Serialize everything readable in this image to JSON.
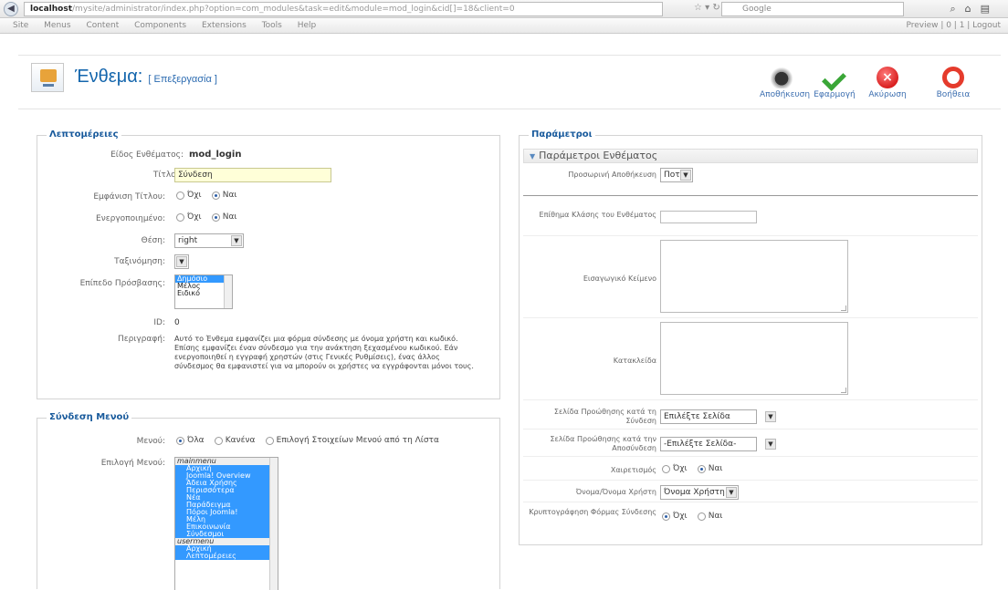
{
  "browser": {
    "url_host": "localhost",
    "url_rest": "/mysite/administrator/index.php?option=com_modules&task=edit&module=mod_login&cid[]=18&client=0",
    "search_placeholder": "Google"
  },
  "admin_menu": {
    "items": [
      "Site",
      "Menus",
      "Content",
      "Components",
      "Extensions",
      "Tools",
      "Help"
    ],
    "right": "Preview  |  0  |  1  |  Logout"
  },
  "toolbar": {
    "title": "Ένθεμα:",
    "subtitle": "[ Επεξεργασία ]",
    "save": "Αποθήκευση",
    "apply": "Εφαρμογή",
    "close": "Ακύρωση",
    "help": "Βοήθεια"
  },
  "details": {
    "legend": "Λεπτομέρειες",
    "module_type_label": "Είδος Ενθέματος:",
    "module_type_value": "mod_login",
    "title_label": "Τίτλος:",
    "title_value": "Σύνδεση",
    "show_title_label": "Εμφάνιση Τίτλου:",
    "enabled_label": "Ενεργοποιημένο:",
    "no": "Όχι",
    "yes": "Ναι",
    "position_label": "Θέση:",
    "position_value": "right",
    "order_label": "Ταξινόμηση:",
    "access_label": "Επίπεδο Πρόσβασης:",
    "access_options": [
      "Δημόσιο",
      "Μέλος",
      "Ειδικό"
    ],
    "id_label": "ID:",
    "id_value": "0",
    "desc_label": "Περιγραφή:",
    "desc_value": "Αυτό το Ένθεμα εμφανίζει μια φόρμα σύνδεσης με όνομα χρήστη και κωδικό. Επίσης εμφανίζει έναν σύνδεσμο για την ανάκτηση ξεχασμένου κωδικού. Εάν ενεργοποιηθεί η εγγραφή χρηστών (στις Γενικές Ρυθμίσεις), ένας άλλος σύνδεσμος θα εμφανιστεί για να μπορούν οι χρήστες να εγγράφονται μόνοι τους."
  },
  "menu_assign": {
    "legend": "Σύνδεση Μενού",
    "menus_label": "Μενού:",
    "opt_all": "Όλα",
    "opt_none": "Κανένα",
    "opt_select": "Επιλογή Στοιχείων Μενού από τη Λίστα",
    "selection_label": "Επιλογή Μενού:",
    "list": [
      {
        "text": "mainmenu",
        "kind": "grp"
      },
      {
        "text": "Αρχική",
        "kind": "on"
      },
      {
        "text": "Joomla! Overview",
        "kind": "on"
      },
      {
        "text": "Άδεια Χρήσης",
        "kind": "on"
      },
      {
        "text": "Περισσότερα",
        "kind": "on"
      },
      {
        "text": "Νέα",
        "kind": "on"
      },
      {
        "text": "Παράδειγμα",
        "kind": "on"
      },
      {
        "text": "Πόροι Joomla!",
        "kind": "on"
      },
      {
        "text": "Μέλη",
        "kind": "on"
      },
      {
        "text": "Επικοινωνία",
        "kind": "on"
      },
      {
        "text": "Σύνδεσμοι",
        "kind": "on"
      },
      {
        "text": "usermenu",
        "kind": "grp"
      },
      {
        "text": "Αρχική",
        "kind": "on"
      },
      {
        "text": "Λεπτομέρειες",
        "kind": "on"
      }
    ]
  },
  "params": {
    "legend": "Παράμετροι",
    "panel_title": "Παράμετροι Ενθέματος",
    "cache_label": "Προσωρινή Αποθήκευση",
    "cache_value": "Ποτέ",
    "class_suffix_label": "Επίθημα Κλάσης του Ενθέματος",
    "pretext_label": "Εισαγωγικό Κείμενο",
    "posttext_label": "Κατακλείδα",
    "login_redirect_label": "Σελίδα Προώθησης κατά τη Σύνδεση",
    "login_redirect_value": "Επιλέξτε Σελίδα",
    "logout_redirect_label": "Σελίδα Προώθησης κατά την Αποσύνδεση",
    "logout_redirect_value": "-Επιλέξτε Σελίδα-",
    "greeting_label": "Χαιρετισμός",
    "name_label": "Όνομα/Όνομα Χρήστη",
    "name_value": "Όνομα Χρήστη",
    "encrypt_label": "Κρυπτογράφηση Φόρμας Σύνδεσης",
    "no": "Όχι",
    "yes": "Ναι"
  }
}
